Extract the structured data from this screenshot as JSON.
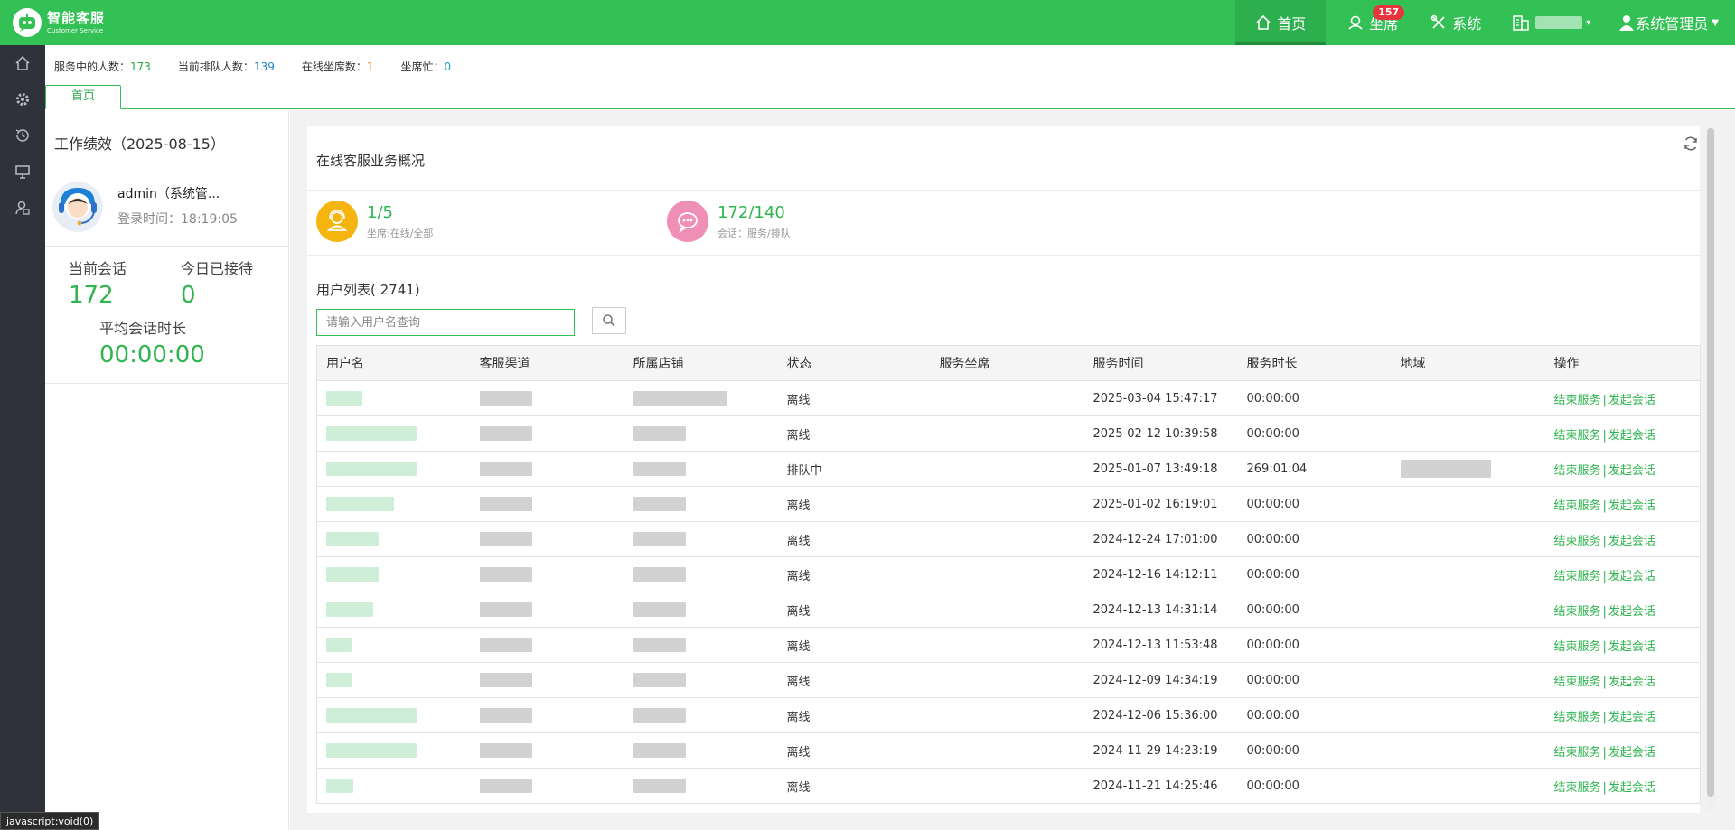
{
  "header": {
    "logo_title": "智能客服",
    "logo_subtitle": "Customer Service",
    "nav": [
      {
        "label": "首页",
        "icon": "home-icon",
        "active": true
      },
      {
        "label": "坐席",
        "icon": "headset-icon",
        "badge": "157"
      },
      {
        "label": "系统",
        "icon": "tools-icon"
      },
      {
        "label": "",
        "icon": "building-icon"
      },
      {
        "label": "系统管理员",
        "icon": "user-icon"
      }
    ]
  },
  "rail": [
    "home-icon",
    "gear-icon",
    "history-icon",
    "monitor-icon",
    "user-settings-icon"
  ],
  "stats": {
    "serving_label": "服务中的人数：",
    "serving_value": "173",
    "queue_label": "当前排队人数：",
    "queue_value": "139",
    "online_label": "在线坐席数：",
    "online_value": "1",
    "busy_label": "坐席忙：",
    "busy_value": "0"
  },
  "tabs": [
    {
      "label": "首页"
    }
  ],
  "perf": {
    "title": "工作绩效（2025-08-15）",
    "user_name": "admin（系统管...",
    "login_label": "登录时间：",
    "login_time": "18:19:05",
    "current_label": "当前会话",
    "current_value": "172",
    "received_label": "今日已接待",
    "received_value": "0",
    "avg_label": "平均会话时长",
    "avg_value": "00:00:00"
  },
  "overview": {
    "title": "在线客服业务概况",
    "agents_value": "1/5",
    "agents_sub": "坐席:在线/全部",
    "sessions_value": "172/140",
    "sessions_sub": "会话：服务/排队"
  },
  "users": {
    "title": "用户列表( 2741)",
    "search_placeholder": "请输入用户名查询",
    "columns": [
      "用户名",
      "客服渠道",
      "所属店铺",
      "状态",
      "服务坐席",
      "服务时间",
      "服务时长",
      "地域",
      "操作"
    ],
    "end_label": "结束服务",
    "sep_label": "|",
    "start_label": "发起会话",
    "rows": [
      {
        "status": "离线",
        "time": "2025-03-04 15:47:17",
        "duration": "00:00:00"
      },
      {
        "status": "离线",
        "time": "2025-02-12 10:39:58",
        "duration": "00:00:00"
      },
      {
        "status": "排队中",
        "time": "2025-01-07 13:49:18",
        "duration": "269:01:04"
      },
      {
        "status": "离线",
        "time": "2025-01-02 16:19:01",
        "duration": "00:00:00"
      },
      {
        "status": "离线",
        "time": "2024-12-24 17:01:00",
        "duration": "00:00:00"
      },
      {
        "status": "离线",
        "time": "2024-12-16 14:12:11",
        "duration": "00:00:00"
      },
      {
        "status": "离线",
        "time": "2024-12-13 14:31:14",
        "duration": "00:00:00"
      },
      {
        "status": "离线",
        "time": "2024-12-13 11:53:48",
        "duration": "00:00:00"
      },
      {
        "status": "离线",
        "time": "2024-12-09 14:34:19",
        "duration": "00:00:00"
      },
      {
        "status": "离线",
        "time": "2024-12-06 15:36:00",
        "duration": "00:00:00"
      },
      {
        "status": "离线",
        "time": "2024-11-29 14:23:19",
        "duration": "00:00:00"
      },
      {
        "status": "离线",
        "time": "2024-11-21 14:25:46",
        "duration": "00:00:00"
      }
    ]
  },
  "statusbar": "javascript:void(0)",
  "colors": {
    "brand": "#33c055",
    "value": "#2fb54e",
    "agents_circle": "#f6b40e",
    "sessions_circle": "#ef8fb5",
    "rail": "#2f323b"
  }
}
